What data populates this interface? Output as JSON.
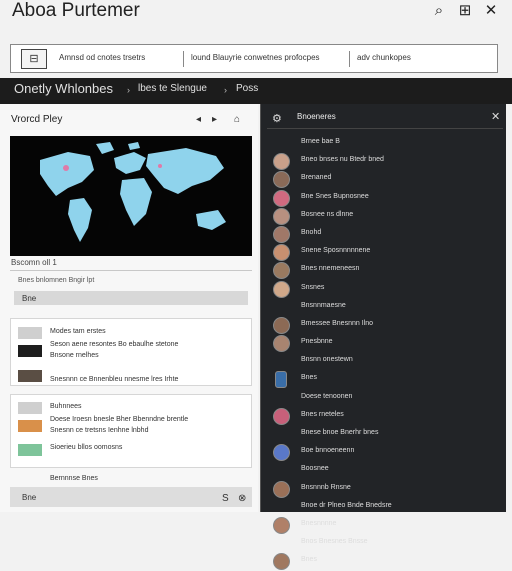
{
  "app": {
    "title": "Aboa Purtemer"
  },
  "window_icons": [
    "search-icon",
    "grid-icon",
    "tools-icon"
  ],
  "toolbar": {
    "items": [
      "Amnsd od cnotes trsetrs",
      "lound Blauyrie conwetnes profocpes",
      "adv chunkopes"
    ]
  },
  "nav": {
    "items": [
      "Onetly Whlonbes",
      "lbes te Slengue",
      "Poss"
    ]
  },
  "left_panel": {
    "title": "Vrorcd Pley",
    "controls": [
      "◂",
      "▸",
      "⌂"
    ],
    "map_subtitle": "Bscomn oll 1",
    "field_hint": "Bnes bnlomnen Bngir lpt",
    "field_label": "Bne",
    "group1": [
      {
        "text": "Modes tam erstes",
        "thumb": "#cfcfcf"
      },
      {
        "text": "Seson aene resontes Bo ebaulhe stetone",
        "thumb": "#1e1e1e"
      },
      {
        "text": "Bnsone rnelhes",
        "thumb": null
      },
      {
        "text": "Snesnnn ce Bnnenbleu nnesme lres Irhte",
        "thumb": "#5a4e44"
      }
    ],
    "group2": [
      {
        "text": "Buhnnees",
        "thumb": "#cfcfcf"
      },
      {
        "text": "Doese Iroesn bnesle Bher Bbenndne brentle",
        "thumb": "#d9904a"
      },
      {
        "text": "Snesnn ce tretsns Ienhne lnbhd",
        "thumb": null
      },
      {
        "text": "Sioerieu bllos oomosns",
        "thumb": "#7ec49a"
      },
      {
        "text": "Bernnnse Bnes",
        "thumb": null
      }
    ],
    "footer_label": "Bne",
    "footer_controls": [
      "S",
      "⊗"
    ]
  },
  "right_panel": {
    "title": "Bnoeneres",
    "rows": [
      {
        "label": "Brnee bae B",
        "avatar": null
      },
      {
        "label": "Bneo bnses nu Btedr bned",
        "avatar": "#c9a08a"
      },
      {
        "label": "Brenaned",
        "avatar": "#8a6a58"
      },
      {
        "label": "Bne Snes Bupnosnee",
        "avatar": "#d06a80"
      },
      {
        "label": "Bosnee ns dlnne",
        "avatar": "#b89080"
      },
      {
        "label": "Bnohd",
        "avatar": "#a07868"
      },
      {
        "label": "Snene Sposnnnnnene",
        "avatar": "#c89070"
      },
      {
        "label": "Bnes nnemeneesn",
        "avatar": "#9a7a60"
      },
      {
        "label": "Snsnes",
        "avatar": "#d0a88a"
      },
      {
        "label": "Bnsnnmaesne",
        "avatar": null
      },
      {
        "label": "Bmessee Bnesnnn Ilno",
        "avatar": "#8c6a55"
      },
      {
        "label": "Pnesbnne",
        "avatar": "#a88470"
      },
      {
        "label": "Bnsnn onestewn",
        "avatar": null
      },
      {
        "label": "Bnes",
        "avatar": "sq:#3a6ea8"
      },
      {
        "label": "Doese tenoonen",
        "avatar": null
      },
      {
        "label": "Bnes rneteles",
        "avatar": "#c8607a"
      },
      {
        "label": "Bnese bnoe Bnerhr bnes",
        "avatar": null
      },
      {
        "label": "Boe bnnoeneenn",
        "avatar": "#5a78c8"
      },
      {
        "label": "Boosnee",
        "avatar": null
      },
      {
        "label": "Bnsnnnb Rnsne",
        "avatar": "#9a7058"
      },
      {
        "label": "Bnoe dr Plneo Bnde Bnedsre",
        "avatar": null
      },
      {
        "label": "Bnesnnnne",
        "avatar": "#b08068"
      },
      {
        "label": "Bnos Bnesnes Bnsse",
        "avatar": null
      },
      {
        "label": "Bnes",
        "avatar": "#a07860"
      }
    ]
  }
}
